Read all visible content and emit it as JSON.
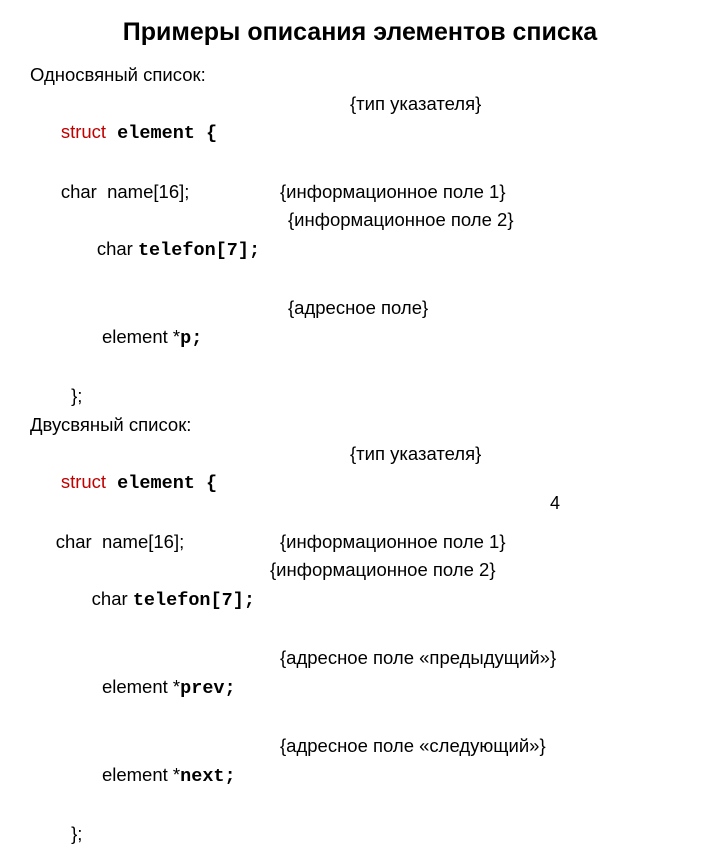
{
  "title": "Примеры описания элементов списка",
  "section1": "Односвяный список:",
  "s1": {
    "l1a": "struct",
    "l1b": " element {",
    "l1c": "{тип указателя}",
    "l2a": "      char  name[16];",
    "l2c": "{информационное поле 1}",
    "l3a": "       char ",
    "l3b": "telefon[7];",
    "l3c": "{информационное поле 2}",
    "l4a": "        element *",
    "l4b": "p",
    "l4bs": ";",
    "l4c": "{адресное поле}",
    "l5a": "        };"
  },
  "section2": "Двусвяный список:",
  "s2": {
    "l1a": "struct",
    "l1b": " element {",
    "l1c": "{тип указателя}",
    "l2a": "     char  name[16];",
    "l2c": "{информационное поле 1}",
    "l3a": "      char ",
    "l3b": "telefon[7];",
    "l3c": "{информационное поле 2}",
    "l4a": "        element *",
    "l4b": "prev",
    "l4bs": ";",
    "l4c": "{адресное поле «предыдущий»}",
    "l5a": "        element *",
    "l5b": "next",
    "l5bs": ";",
    "l5c": "{адресное поле «следующий»}",
    "l6a": "        };"
  },
  "pagenum": "4"
}
